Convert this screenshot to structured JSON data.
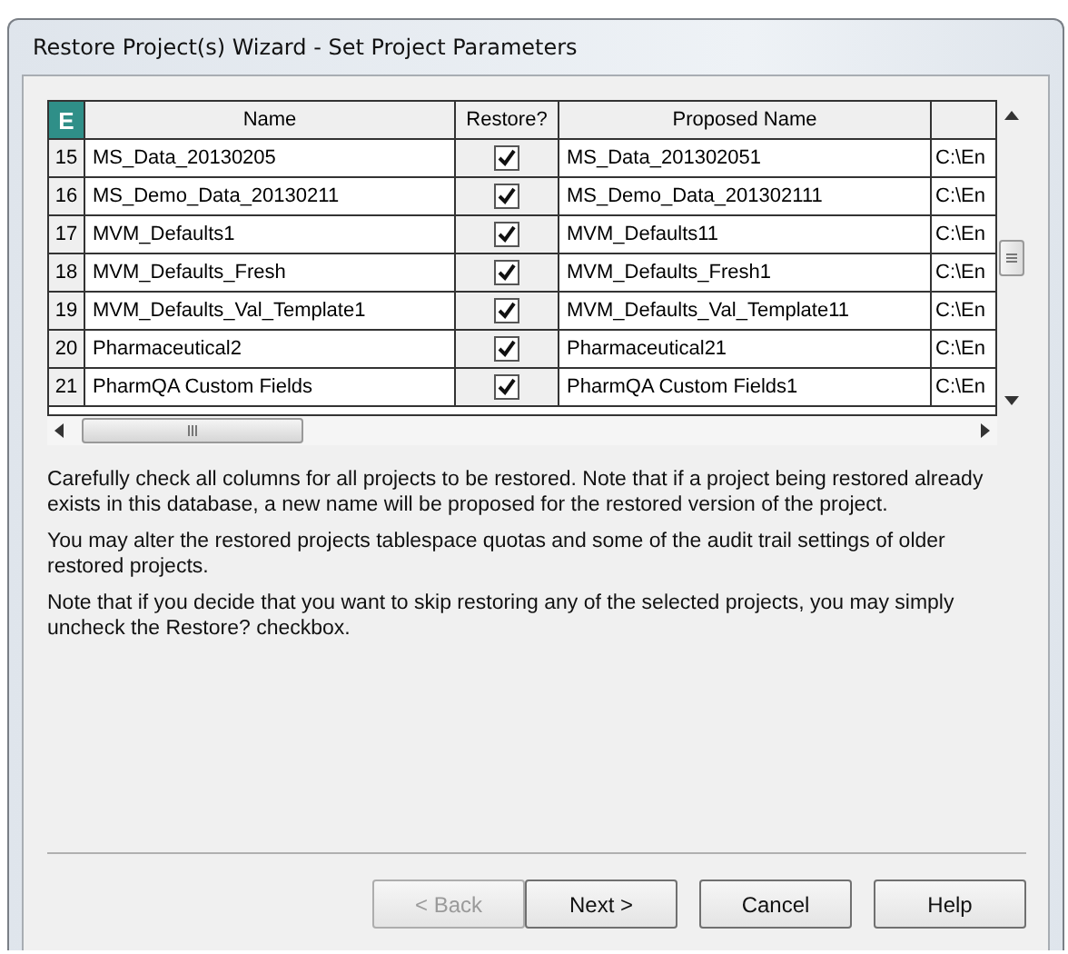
{
  "window": {
    "title": "Restore Project(s) Wizard - Set Project Parameters"
  },
  "table": {
    "corner_label": "E",
    "columns": [
      "Name",
      "Restore?",
      "Proposed Name"
    ],
    "rows": [
      {
        "number": "15",
        "name": "MS_Data_20130205",
        "restore": true,
        "proposed": "MS_Data_201302051",
        "column_5": "C:\\En"
      },
      {
        "number": "16",
        "name": "MS_Demo_Data_20130211",
        "restore": true,
        "proposed": "MS_Demo_Data_201302111",
        "column_5": "C:\\En"
      },
      {
        "number": "17",
        "name": "MVM_Defaults1",
        "restore": true,
        "proposed": "MVM_Defaults11",
        "column_5": "C:\\En"
      },
      {
        "number": "18",
        "name": "MVM_Defaults_Fresh",
        "restore": true,
        "proposed": "MVM_Defaults_Fresh1",
        "column_5": "C:\\En"
      },
      {
        "number": "19",
        "name": "MVM_Defaults_Val_Template1",
        "restore": true,
        "proposed": "MVM_Defaults_Val_Template11",
        "column_5": "C:\\En"
      },
      {
        "number": "20",
        "name": "Pharmaceutical2",
        "restore": true,
        "proposed": "Pharmaceutical21",
        "column_5": "C:\\En"
      },
      {
        "number": "21",
        "name": "PharmQA Custom Fields",
        "restore": true,
        "proposed": "PharmQA Custom Fields1",
        "column_5": "C:\\En"
      }
    ]
  },
  "instructions": [
    "Carefully check all columns for all projects to be restored.  Note that if a project being restored already exists in this database, a new name will be proposed for the restored version of the project.",
    "You may alter the restored projects tablespace quotas and some of the audit trail settings of older restored projects.",
    "Note that if you decide that you want to skip restoring any of the selected projects, you may simply uncheck the Restore? checkbox."
  ],
  "buttons": [
    {
      "label": "< Back",
      "disabled": true
    },
    {
      "label": "Next >",
      "disabled": false
    },
    {
      "label": "Cancel",
      "disabled": false
    },
    {
      "label": "Help",
      "disabled": false
    }
  ]
}
